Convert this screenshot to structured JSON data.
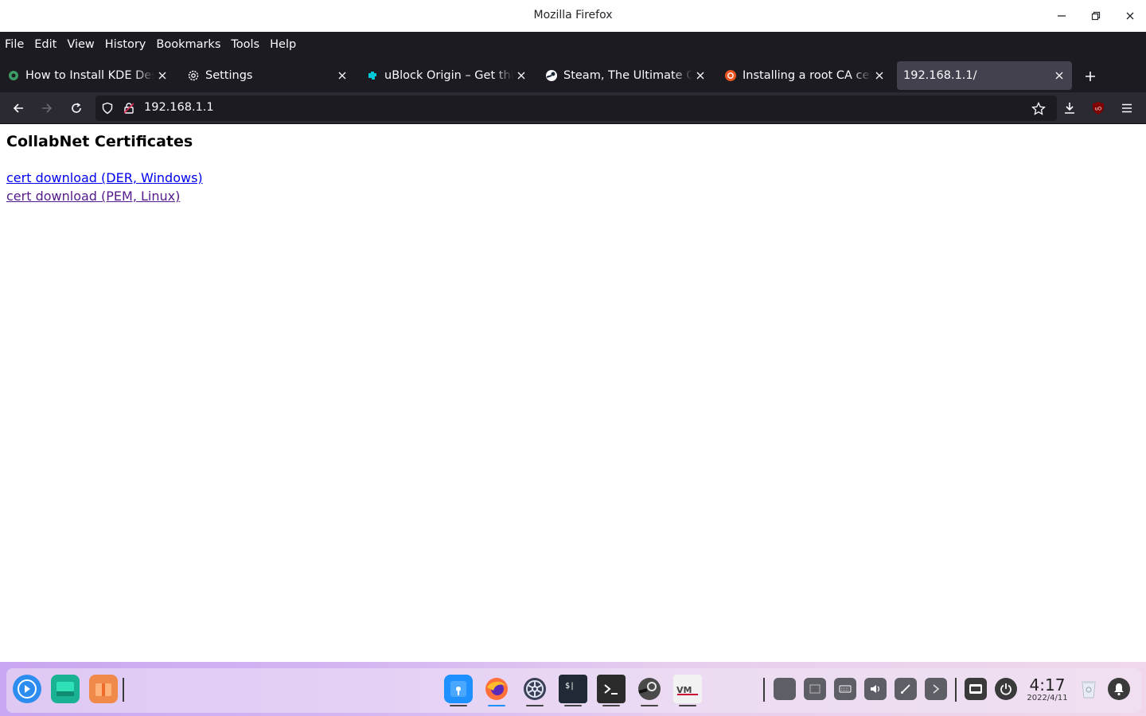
{
  "window": {
    "title": "Mozilla Firefox"
  },
  "menu": [
    "File",
    "Edit",
    "View",
    "History",
    "Bookmarks",
    "Tools",
    "Help"
  ],
  "tabs": [
    {
      "label": "How to Install KDE Desktop",
      "icon": "kde-gear-icon",
      "active": false
    },
    {
      "label": "Settings",
      "icon": "gear-icon",
      "active": false
    },
    {
      "label": "uBlock Origin – Get this Extension",
      "icon": "puzzle-icon",
      "active": false
    },
    {
      "label": "Steam, The Ultimate Online Game Platform",
      "icon": "steam-icon",
      "active": false
    },
    {
      "label": "Installing a root CA certificate",
      "icon": "ubuntu-icon",
      "active": false
    },
    {
      "label": "192.168.1.1/",
      "icon": "",
      "active": true
    }
  ],
  "navbar": {
    "url": "192.168.1.1"
  },
  "page": {
    "heading": "CollabNet Certificates",
    "links": [
      "cert download (DER, Windows)",
      "cert download (PEM, Linux)"
    ]
  },
  "taskbar": {
    "time": "4:17",
    "date": "2022/4/11"
  },
  "colors": {
    "chrome_dark": "#1c1b22",
    "toolbar": "#2b2a33",
    "link": "#0000ee",
    "visited": "#551a8b"
  }
}
